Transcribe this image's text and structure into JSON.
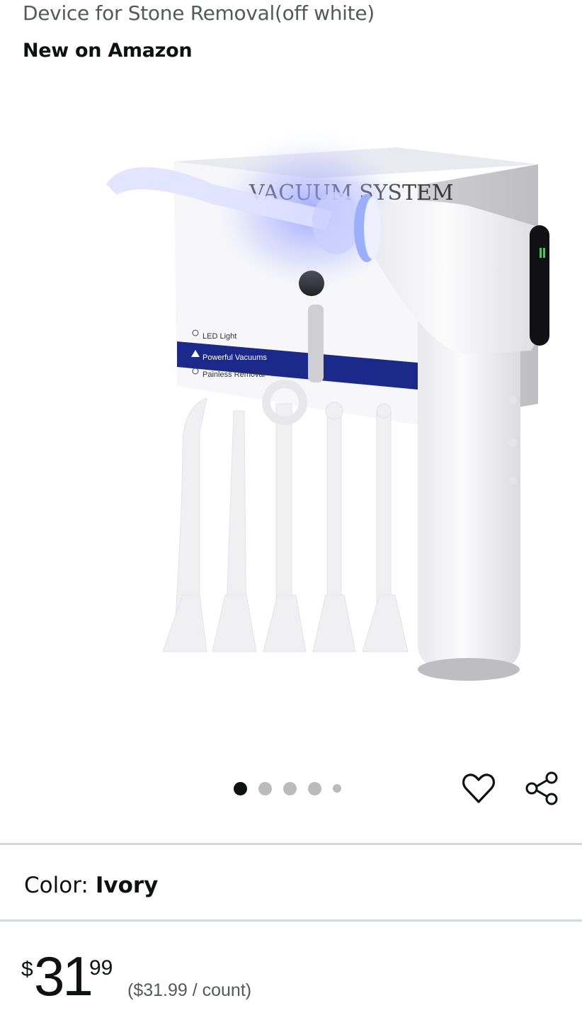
{
  "product": {
    "title": "Device for Stone Removal(off white)",
    "badge": "New on Amazon"
  },
  "gallery": {
    "dot_count": 5,
    "active_dot": 1,
    "box_heading": "VACUUM SYSTEM",
    "box_features": [
      "LED Light",
      "Powerful Vacuums",
      "Painless Removal"
    ]
  },
  "actions": {
    "favorite_icon": "heart-icon",
    "share_icon": "share-icon"
  },
  "variation": {
    "label": "Color:",
    "value": "Ivory"
  },
  "price": {
    "symbol": "$",
    "whole": "31",
    "fraction": "99",
    "unit_price": "($31.99 / count)"
  },
  "colors": {
    "text_primary": "#0f1111",
    "text_secondary": "#565959",
    "divider": "#d5d9d9",
    "box_band": "#1b2a8a",
    "led_glow": "#6f7cff"
  }
}
